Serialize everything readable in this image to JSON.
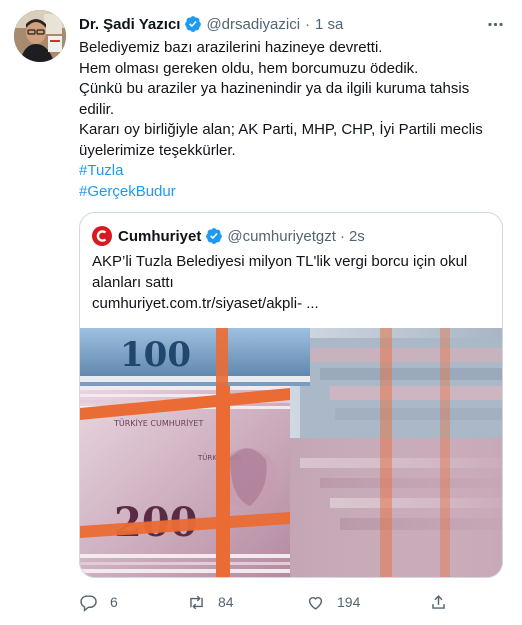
{
  "author": {
    "name": "Dr. Şadi Yazıcı",
    "handle": "@drsadiyazici",
    "separator": "·",
    "time": "1 sa"
  },
  "tweet": {
    "lines": [
      "Belediyemiz bazı arazilerini hazineye devretti.",
      "Hem olması gereken oldu, hem borcumuzu ödedik.",
      "Çünkü bu araziler ya hazinenindir ya da ilgili kuruma tahsis",
      "edilir.",
      "Kararı oy birliğiyle alan; AK Parti, MHP, CHP, İyi Partili meclis",
      "üyelerimize teşekkürler."
    ],
    "hashtags": [
      "#Tuzla",
      "#GerçekBudur"
    ]
  },
  "quote": {
    "name": "Cumhuriyet",
    "handle": "@cumhuriyetgzt",
    "separator": "·",
    "time": "2s",
    "lines": [
      "AKP’li Tuzla Belediyesi milyon TL'lik vergi borcu için okul",
      "alanları sattı"
    ],
    "link": "cumhuriyet.com.tr/siyaset/akpli-       ...",
    "image": {
      "banknote_top": "100",
      "banknote_bottom": "200",
      "bank_text": "TÜRKİYE CUMHURİYET",
      "currency_text": "TÜRK LİRASI"
    }
  },
  "actions": {
    "replies": "6",
    "retweets": "84",
    "likes": "194"
  },
  "colors": {
    "accent": "#1d9bf0",
    "secondary_text": "#536471",
    "border": "#cfd9de",
    "cumhuriyet_red": "#d71920"
  }
}
